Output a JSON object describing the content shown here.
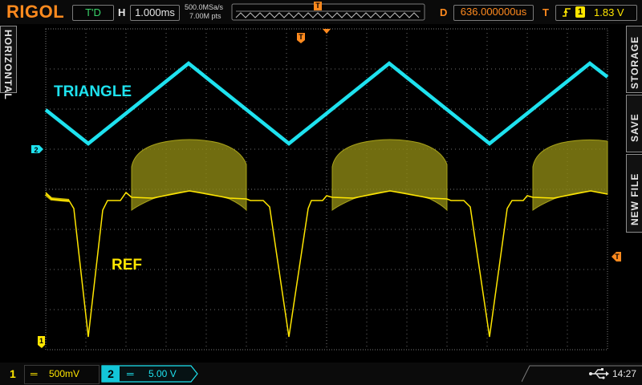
{
  "colors": {
    "ch1": "#ffe600",
    "ch2": "#1ee2ef",
    "accent": "#ff8a1e",
    "grid": "#6e6e6e"
  },
  "header": {
    "brand": "RIGOL",
    "run_state": "T'D",
    "horizontal_label": "H",
    "timebase": "1.000ms",
    "sample_rate": "500.0MSa/s",
    "memory_depth": "7.00M pts",
    "delay_label": "D",
    "delay_value": "636.000000us",
    "trigger_label": "T",
    "trigger_source": "1",
    "trigger_level": "1.83 V",
    "trigger_marker": "T"
  },
  "side_left": {
    "horizontal_tab": "HORIZONTAL"
  },
  "side_right": {
    "storage_tab": "STORAGE",
    "save_tab": "SAVE",
    "newfile_tab": "NEW FILE"
  },
  "traces": {
    "ch2_name": "TRIANGLE",
    "ch1_name": "REF"
  },
  "markers": {
    "ch2_marker": "2",
    "ch1_marker": "1",
    "trigger_level_marker": "T",
    "trigger_position_marker": "T"
  },
  "footer": {
    "ch1_number": "1",
    "ch1_coupling": "═",
    "ch1_scale": "500mV",
    "ch2_number": "2",
    "ch2_coupling": "═",
    "ch2_scale": "5.00 V",
    "usb": "usb-icon",
    "time": "14:27"
  }
}
